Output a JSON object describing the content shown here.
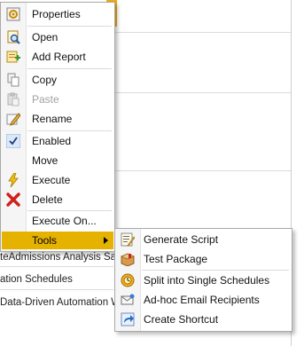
{
  "background": {
    "rows": [
      {
        "text": "teAdmissions Analysis Sam"
      },
      {
        "text": "ation Schedules"
      },
      {
        "text": "Data-Driven Automation W."
      }
    ]
  },
  "context_menu": {
    "items": [
      {
        "label": "Properties",
        "icon": "properties-icon"
      },
      {
        "label": "Open",
        "icon": "open-icon"
      },
      {
        "label": "Add Report",
        "icon": "add-report-icon"
      },
      {
        "label": "Copy",
        "icon": "copy-icon"
      },
      {
        "label": "Paste",
        "icon": "paste-icon",
        "disabled": true
      },
      {
        "label": "Rename",
        "icon": "rename-icon"
      },
      {
        "label": "Enabled",
        "icon": "check-icon"
      },
      {
        "label": "Move",
        "icon": ""
      },
      {
        "label": "Execute",
        "icon": "execute-icon"
      },
      {
        "label": "Delete",
        "icon": "delete-icon"
      },
      {
        "label": "Execute On...",
        "icon": ""
      },
      {
        "label": "Tools",
        "icon": "",
        "active": true,
        "has_submenu": true
      }
    ]
  },
  "submenu": {
    "items": [
      {
        "label": "Generate Script",
        "icon": "script-icon"
      },
      {
        "label": "Test Package",
        "icon": "package-icon"
      },
      {
        "label": "Split into Single Schedules",
        "icon": "split-icon"
      },
      {
        "label": "Ad-hoc Email Recipients",
        "icon": "email-icon"
      },
      {
        "label": "Create Shortcut",
        "icon": "shortcut-icon"
      }
    ]
  },
  "colors": {
    "highlight": "#e6b200",
    "accent_orange": "#f0a810"
  }
}
